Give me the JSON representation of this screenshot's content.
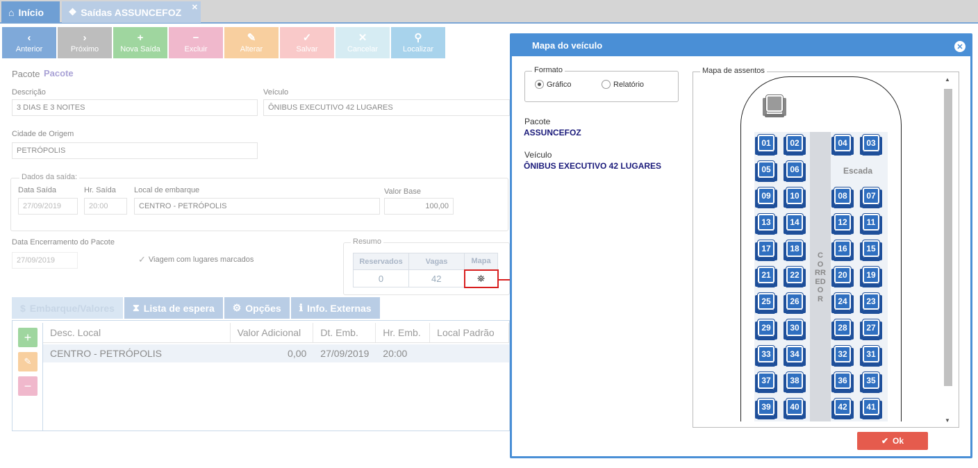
{
  "tabs": {
    "home": "Início",
    "saidas": "Saídas ASSUNCEFOZ",
    "close": "✕"
  },
  "toolbar": [
    {
      "icon": "‹",
      "label": "Anterior",
      "color": "#7fa9d9"
    },
    {
      "icon": "›",
      "label": "Próximo",
      "color": "#bdbdbd"
    },
    {
      "icon": "+",
      "label": "Nova Saída",
      "color": "#9fd69f"
    },
    {
      "icon": "−",
      "label": "Excluir",
      "color": "#f0b8cc"
    },
    {
      "icon": "✎",
      "label": "Alterar",
      "color": "#f8cf9f"
    },
    {
      "icon": "✓",
      "label": "Salvar",
      "color": "#f9c9c9"
    },
    {
      "icon": "✕",
      "label": "Cancelar",
      "color": "#d6ecf3"
    },
    {
      "icon": "⚲",
      "label": "Localizar",
      "color": "#a8d3ec"
    }
  ],
  "form": {
    "pacote_label": "Pacote",
    "pacote_value": "Pacote",
    "descricao_label": "Descrição",
    "descricao_value": "3 DIAS E 3 NOITES",
    "veiculo_label": "Veículo",
    "veiculo_value": "ÔNIBUS EXECUTIVO 42 LUGARES",
    "cidade_label": "Cidade de Origem",
    "cidade_value": "PETRÓPOLIS",
    "dados_legend": "Dados da saída:",
    "data_saida_label": "Data Saída",
    "data_saida_value": "27/09/2019",
    "hr_saida_label": "Hr. Saída",
    "hr_saida_value": "20:00",
    "local_label": "Local de embarque",
    "local_value": "CENTRO - PETRÓPOLIS",
    "valor_base_label": "Valor Base",
    "valor_base_value": "100,00",
    "encerramento_label": "Data Encerramento do Pacote",
    "encerramento_value": "27/09/2019",
    "viagem_label": "Viagem com lugares marcados"
  },
  "resumo": {
    "legend": "Resumo",
    "headers": [
      "Reservados",
      "Vagas",
      "Mapa"
    ],
    "reservados": "0",
    "vagas": "42"
  },
  "lower_tabs": [
    {
      "icon": "$",
      "label": "Embarque/Valores"
    },
    {
      "icon": "⧗",
      "label": "Lista de espera"
    },
    {
      "icon": "⚙",
      "label": "Opções"
    },
    {
      "icon": "ℹ",
      "label": "Info. Externas"
    }
  ],
  "grid": {
    "columns": [
      "Desc. Local",
      "Valor Adicional",
      "Dt. Emb.",
      "Hr. Emb.",
      "Local Padrão"
    ],
    "rows": [
      [
        "CENTRO - PETRÓPOLIS",
        "0,00",
        "27/09/2019",
        "20:00",
        ""
      ]
    ]
  },
  "modal": {
    "title": "Mapa do veículo",
    "formato_legend": "Formato",
    "option_grafico": "Gráfico",
    "option_relatorio": "Relatório",
    "pacote_label": "Pacote",
    "pacote_value": "ASSUNCEFOZ",
    "veiculo_label": "Veículo",
    "veiculo_value": "ÔNIBUS EXECUTIVO 42 LUGARES",
    "mapa_legend": "Mapa de assentos",
    "escada": "Escada",
    "corredor": "CORREDOR",
    "ok_label": "Ok",
    "seat_rows": [
      [
        "01",
        "02",
        "04",
        "03"
      ],
      [
        "05",
        "06",
        "",
        ""
      ],
      [
        "09",
        "10",
        "08",
        "07"
      ],
      [
        "13",
        "14",
        "12",
        "11"
      ],
      [
        "17",
        "18",
        "16",
        "15"
      ],
      [
        "21",
        "22",
        "20",
        "19"
      ],
      [
        "25",
        "26",
        "24",
        "23"
      ],
      [
        "29",
        "30",
        "28",
        "27"
      ],
      [
        "33",
        "34",
        "32",
        "31"
      ],
      [
        "37",
        "38",
        "36",
        "35"
      ],
      [
        "39",
        "40",
        "42",
        "41"
      ]
    ]
  }
}
